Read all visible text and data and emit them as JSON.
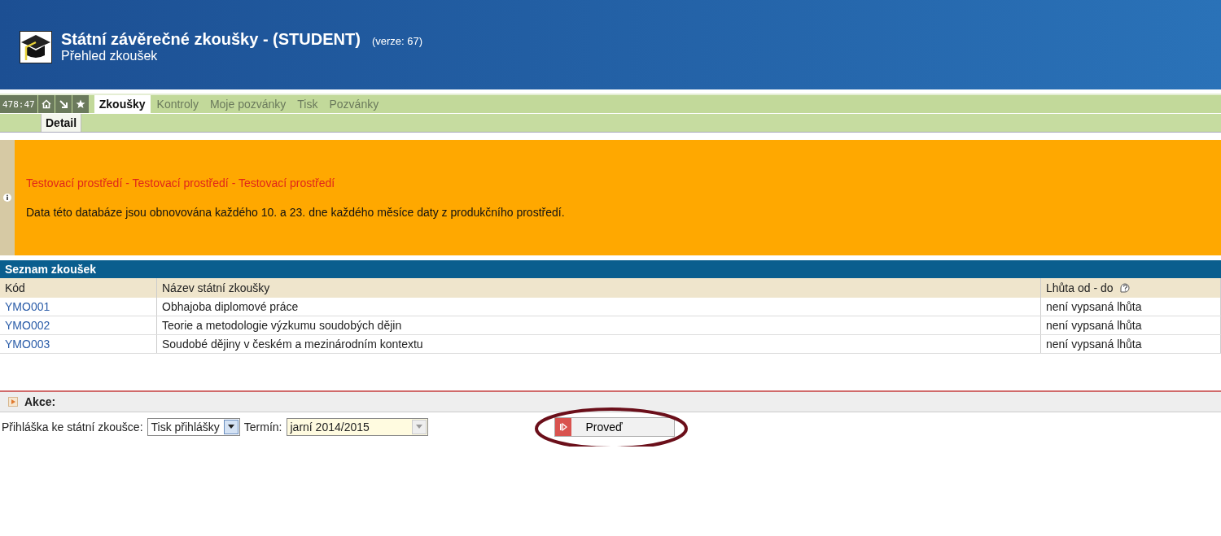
{
  "header": {
    "title": "Státní závěrečné zkoušky - (STUDENT)",
    "version": "(verze: 67)",
    "subtitle": "Přehled zkoušek"
  },
  "toolbar": {
    "timer": "478:47"
  },
  "tabs": [
    {
      "label": "Zkoušky",
      "selected": true
    },
    {
      "label": "Kontroly",
      "selected": false
    },
    {
      "label": "Moje pozvánky",
      "selected": false
    },
    {
      "label": "Tisk",
      "selected": false
    },
    {
      "label": "Pozvánky",
      "selected": false
    }
  ],
  "subtabs": [
    {
      "label": "Detail",
      "selected": true
    }
  ],
  "notice": {
    "warning": "Testovací prostředí - Testovací prostředí - Testovací prostředí",
    "message": "Data této databáze jsou obnovována každého 10. a 23. dne každého měsíce daty z produkčního prostředí."
  },
  "table": {
    "title": "Seznam zkoušek",
    "columns": [
      "Kód",
      "Název státní zkoušky",
      "Lhůta od - do"
    ],
    "rows": [
      {
        "code": "YMO001",
        "name": "Obhajoba diplomové práce",
        "deadline": "není vypsaná lhůta"
      },
      {
        "code": "YMO002",
        "name": "Teorie a metodologie výzkumu soudobých dějin",
        "deadline": "není vypsaná lhůta"
      },
      {
        "code": "YMO003",
        "name": "Soudobé dějiny v českém a mezinárodním kontextu",
        "deadline": "není vypsaná lhůta"
      }
    ]
  },
  "actions": {
    "title": "Akce:",
    "application_label": "Přihláška ke státní zkoušce:",
    "application_value": "Tisk přihlášky",
    "term_label": "Termín:",
    "term_value": "jarní 2014/2015",
    "button": "Proveď"
  }
}
